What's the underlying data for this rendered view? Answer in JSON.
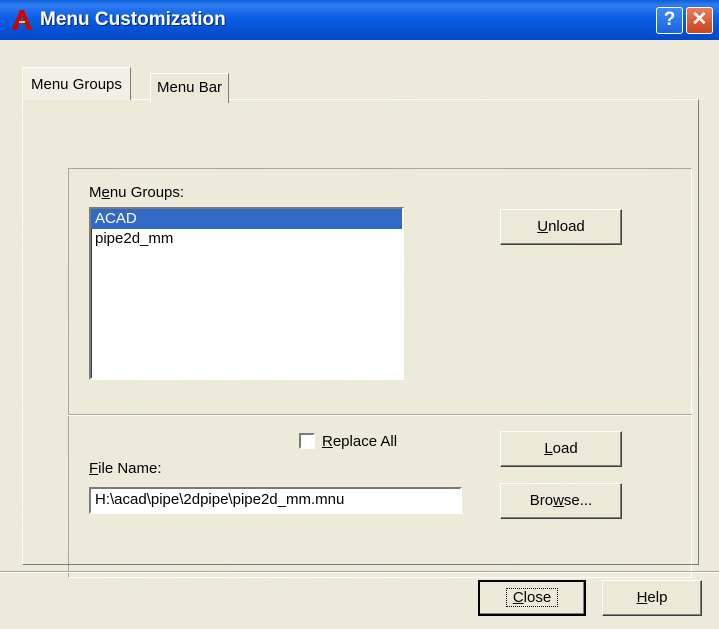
{
  "window": {
    "title": "Menu Customization",
    "help_button": "?",
    "close_button": "✕"
  },
  "tabs": [
    {
      "label": "Menu Groups",
      "active": true
    },
    {
      "label": "Menu Bar",
      "active": false
    }
  ],
  "menu_groups": {
    "label_prefix": "M",
    "label_mnemonic": "e",
    "label_suffix": "nu Groups:",
    "items": [
      {
        "label": "ACAD",
        "selected": true
      },
      {
        "label": "pipe2d_mm",
        "selected": false
      }
    ],
    "unload_mnemonic": "U",
    "unload_rest": "nload"
  },
  "load_section": {
    "replace_all_mnemonic": "R",
    "replace_all_rest": "eplace All",
    "replace_all_checked": false,
    "load_mnemonic": "L",
    "load_rest": "oad",
    "file_name_mnemonic": "F",
    "file_name_rest": "ile Name:",
    "file_name_value": "H:\\acad\\pipe\\2dpipe\\pipe2d_mm.mnu",
    "browse_prefix": "Bro",
    "browse_mnemonic": "w",
    "browse_suffix": "se..."
  },
  "footer": {
    "close_mnemonic": "C",
    "close_rest": "lose",
    "help_mnemonic": "H",
    "help_rest": "elp"
  },
  "colors": {
    "titlebar": "#0a5ee6",
    "selection": "#316ac5",
    "dialog_bg": "#ece9d8"
  }
}
